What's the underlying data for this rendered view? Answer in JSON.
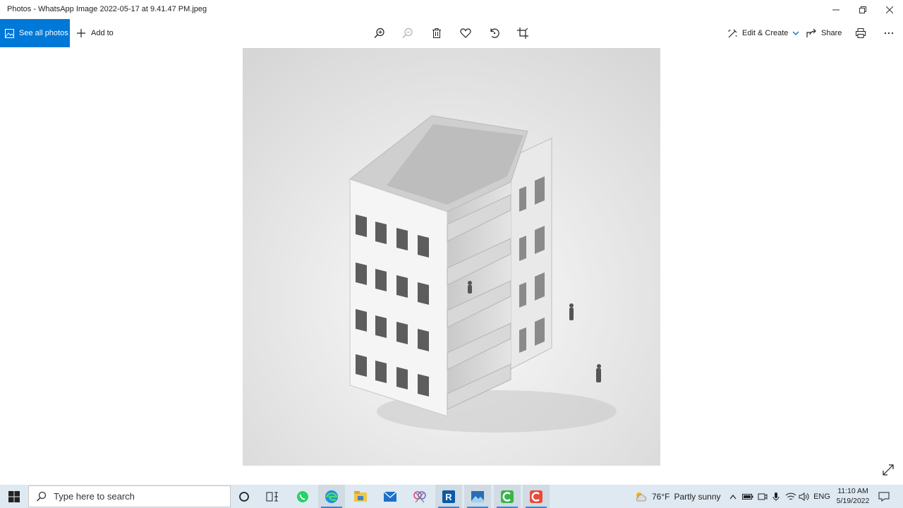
{
  "window": {
    "title": "Photos - WhatsApp Image 2022-05-17 at 9.41.47 PM.jpeg",
    "controls": [
      "minimize-icon",
      "restore-icon",
      "close-icon"
    ]
  },
  "toolbar": {
    "see_all_label": "See all photos",
    "add_to_label": "Add to",
    "edit_create_label": "Edit & Create",
    "share_label": "Share",
    "icons": [
      "zoom-in-icon",
      "zoom-out-icon",
      "delete-icon",
      "favorite-icon",
      "rotate-icon",
      "crop-icon",
      "print-icon",
      "more-icon"
    ]
  },
  "taskbar": {
    "search_placeholder": "Type here to search",
    "pinned_apps": [
      "cortana-icon",
      "task-view-icon",
      "whatsapp-icon",
      "edge-icon",
      "file-explorer-icon",
      "mail-icon",
      "snip-icon",
      "revit-icon",
      "photos-icon",
      "camtasia-green-icon",
      "camtasia-red-icon"
    ],
    "weather": {
      "temp": "76°F",
      "condition": "Partly sunny"
    },
    "language": "ENG",
    "time": "11:10 AM",
    "date": "5/19/2022",
    "accent": "#0078d7"
  }
}
